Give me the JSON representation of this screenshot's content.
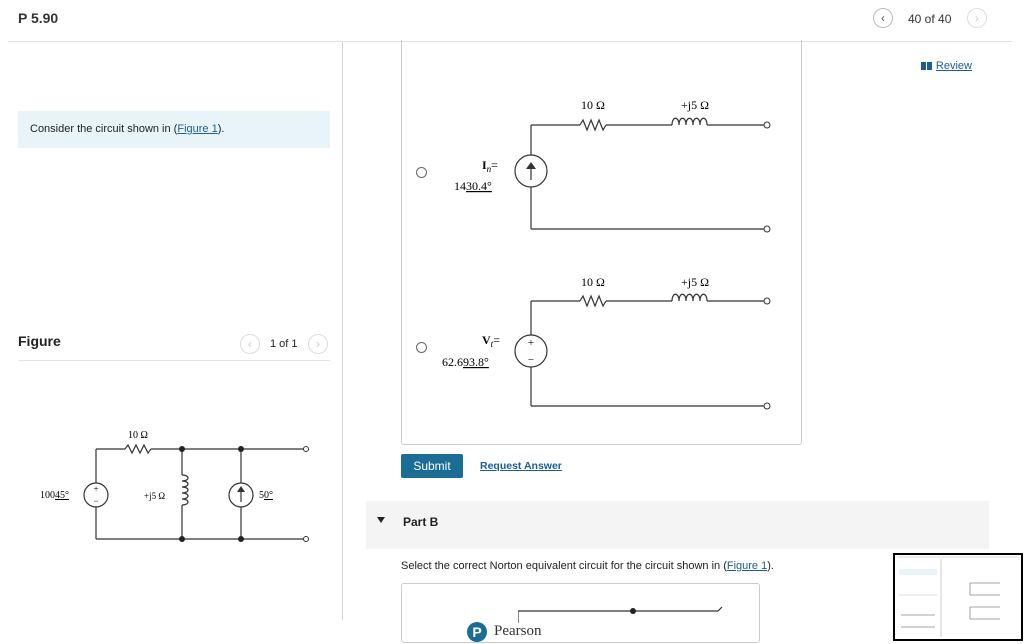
{
  "header": {
    "title": "P 5.90",
    "prev_icon": "‹",
    "next_icon": "›",
    "counter": "40 of 40",
    "review_label": "Review"
  },
  "left": {
    "prompt_prefix": "Consider the circuit shown in (",
    "prompt_link": "Figure 1",
    "prompt_suffix": ").",
    "figure_heading": "Figure",
    "figure_counter": "1 of 1",
    "circuit": {
      "r_label": "10 Ω",
      "v_source": "100",
      "v_source_angle": "45°",
      "l_label": "+j5 Ω",
      "i_source": "5",
      "i_source_angle": "0°"
    }
  },
  "partA": {
    "options": [
      {
        "r_label": "10 Ω",
        "l_label": "+j5 Ω",
        "source_name": "I",
        "source_sub": "n",
        "source_eq": "=",
        "mag": "14",
        "ang": "30.4°"
      },
      {
        "r_label": "10 Ω",
        "l_label": "+j5 Ω",
        "source_name": "V",
        "source_sub": "t",
        "source_eq": "=",
        "mag": "62.6",
        "ang": "93.8°"
      }
    ],
    "submit_label": "Submit",
    "request_answer_label": "Request Answer"
  },
  "partB": {
    "label": "Part B",
    "question_prefix": "Select the correct Norton equivalent circuit for the circuit shown in (",
    "question_link": "Figure 1",
    "question_suffix": ")."
  },
  "footer": {
    "brand": "Pearson",
    "logo_letter": "P"
  }
}
